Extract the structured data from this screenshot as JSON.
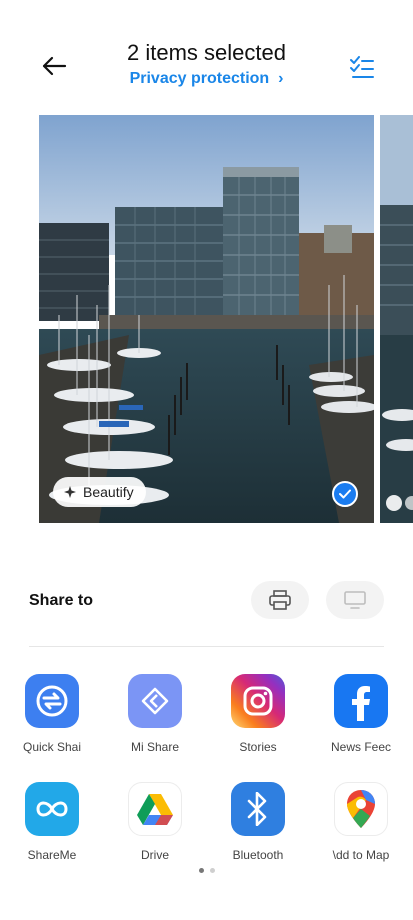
{
  "header": {
    "title": "2 items selected",
    "subtitle": "Privacy protection"
  },
  "photo": {
    "beautify_label": "Beautify"
  },
  "share": {
    "title": "Share to",
    "apps": [
      {
        "label": "Quick Shai",
        "icon": "quick-share-icon",
        "color": "#3d7ff0"
      },
      {
        "label": "Mi Share",
        "icon": "mi-share-icon",
        "color": "#7b95f5"
      },
      {
        "label": "Stories",
        "icon": "instagram-icon",
        "color": "#d62976"
      },
      {
        "label": "News Feec",
        "icon": "facebook-icon",
        "color": "#1877f2"
      },
      {
        "label": "ShareMe",
        "icon": "shareme-icon",
        "color": "#22a8e8"
      },
      {
        "label": "Drive",
        "icon": "google-drive-icon",
        "color": "#ffffff"
      },
      {
        "label": "Bluetooth",
        "icon": "bluetooth-icon",
        "color": "#2f7fe0"
      },
      {
        "label": "\\dd to Map",
        "icon": "google-maps-icon",
        "color": "#ffffff"
      }
    ]
  },
  "accent_color": "#1a86e8"
}
